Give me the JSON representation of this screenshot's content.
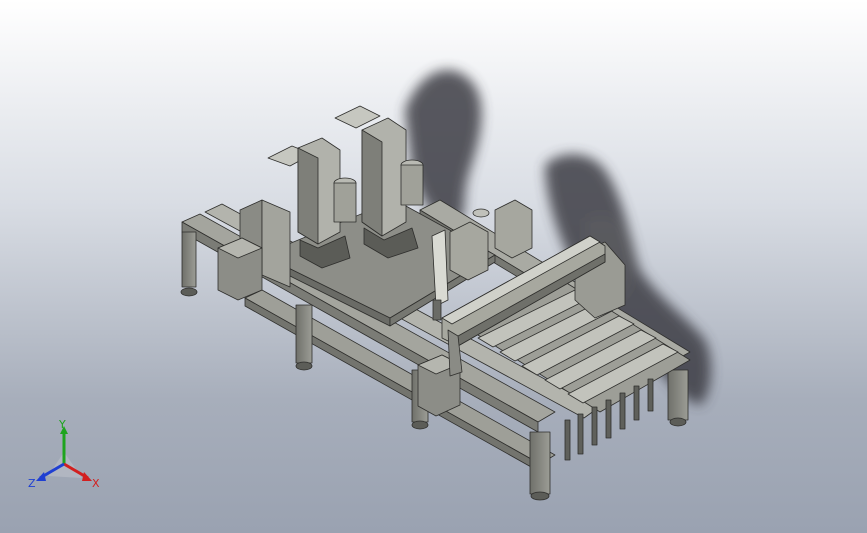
{
  "viewport": {
    "background_top": "#ffffff",
    "background_bottom": "#9aa2b1",
    "model_color": "#8f908a",
    "model_shade": "#6b6c67",
    "shadow_color": "#404046"
  },
  "triad": {
    "x_label": "X",
    "y_label": "Y",
    "z_label": "Z",
    "x_color": "#d21f1f",
    "y_color": "#1ea41e",
    "z_color": "#1f3fd2"
  }
}
